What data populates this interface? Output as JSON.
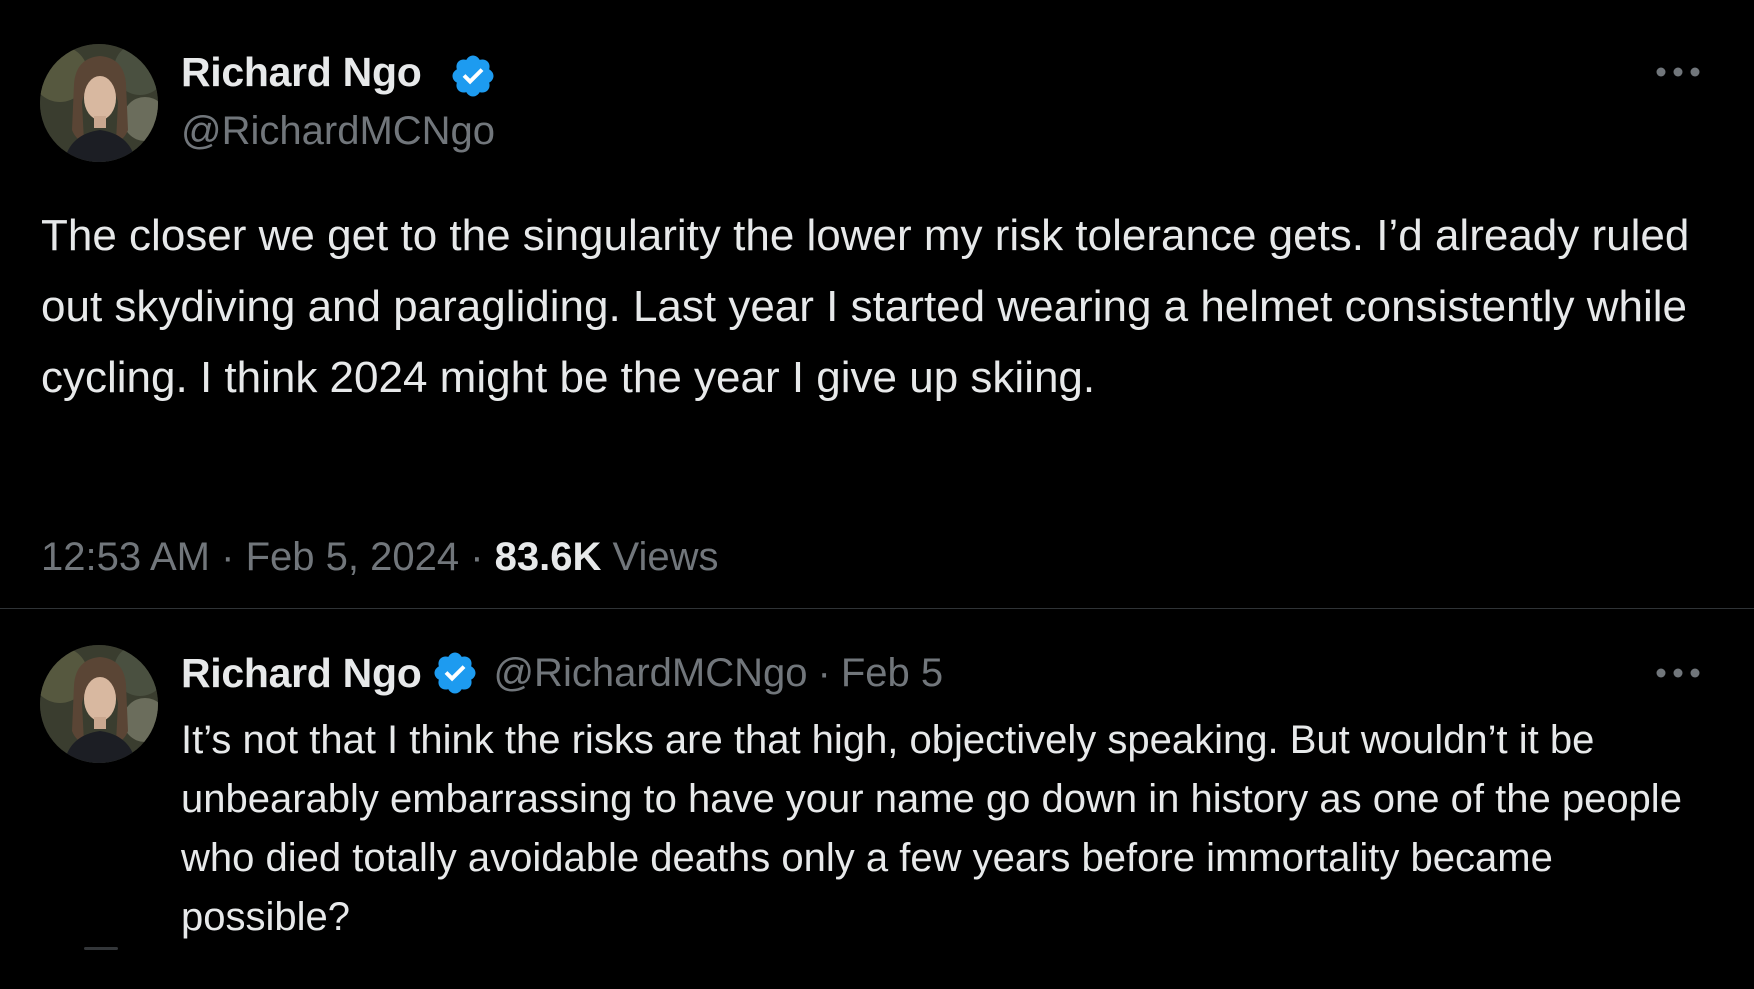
{
  "main_tweet": {
    "author_name": "Richard Ngo",
    "author_handle": "@RichardMCNgo",
    "verified_icon": "verified-badge-icon",
    "more_icon": "more-horizontal-icon",
    "text": "The closer we get to the singularity the lower my risk tolerance gets. I’d already ruled out skydiving and paragliding. Last year I started wearing a helmet consistently while cycling. I think 2024 might be the year I give up skiing.",
    "time": "12:53 AM",
    "date": "Feb 5, 2024",
    "separator": "·",
    "views_count": "83.6K",
    "views_label": "Views"
  },
  "reply_tweet": {
    "author_name": "Richard Ngo",
    "author_handle": "@RichardMCNgo",
    "separator": "·",
    "date": "Feb 5",
    "verified_icon": "verified-badge-icon",
    "more_icon": "more-horizontal-icon",
    "text": "It’s not that I think the risks are that high, objectively speaking. But wouldn’t it be unbearably embarrassing to have your name go down in history as one of the people who died totally avoidable deaths only a few years before immortality became possible?"
  },
  "colors": {
    "background": "#000000",
    "primary_text": "#e7e9ea",
    "secondary_text": "#71767b",
    "verified_blue": "#1d9bf0",
    "divider": "#2f3336"
  }
}
